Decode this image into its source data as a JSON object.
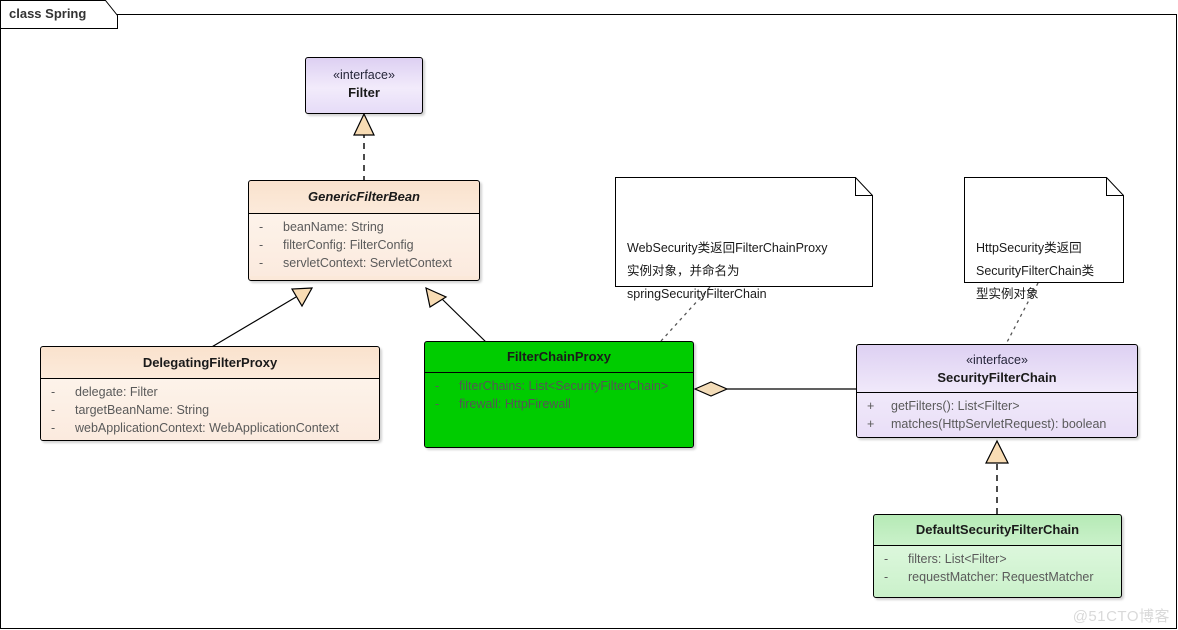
{
  "frame": {
    "label": "class Spring"
  },
  "watermark": "@51CTO博客",
  "colors": {
    "interface_fill": "#e3d6f5",
    "abstract_fill": "#fae2cd",
    "highlight_green": "#00cc00",
    "light_green": "#c8f0c8",
    "arrow_fill": "#f8dcb4",
    "line": "#000000"
  },
  "classes": {
    "filter": {
      "stereotype": "«interface»",
      "name": "Filter",
      "attributes": []
    },
    "generic_filter_bean": {
      "stereotype": "",
      "name": "GenericFilterBean",
      "attributes": [
        {
          "visibility": "-",
          "text": "beanName: String"
        },
        {
          "visibility": "-",
          "text": "filterConfig: FilterConfig"
        },
        {
          "visibility": "-",
          "text": "servletContext: ServletContext"
        }
      ]
    },
    "delegating_filter_proxy": {
      "stereotype": "",
      "name": "DelegatingFilterProxy",
      "attributes": [
        {
          "visibility": "-",
          "text": "delegate: Filter"
        },
        {
          "visibility": "-",
          "text": "targetBeanName: String"
        },
        {
          "visibility": "-",
          "text": "webApplicationContext: WebApplicationContext"
        }
      ]
    },
    "filter_chain_proxy": {
      "stereotype": "",
      "name": "FilterChainProxy",
      "attributes": [
        {
          "visibility": "-",
          "text": "filterChains: List<SecurityFilterChain>"
        },
        {
          "visibility": "-",
          "text": "firewall: HttpFirewall"
        }
      ]
    },
    "security_filter_chain": {
      "stereotype": "«interface»",
      "name": "SecurityFilterChain",
      "attributes": [
        {
          "visibility": "+",
          "text": "getFilters(): List<Filter>"
        },
        {
          "visibility": "+",
          "text": "matches(HttpServletRequest): boolean"
        }
      ]
    },
    "default_security_filter_chain": {
      "stereotype": "",
      "name": "DefaultSecurityFilterChain",
      "attributes": [
        {
          "visibility": "-",
          "text": "filters: List<Filter>"
        },
        {
          "visibility": "-",
          "text": "requestMatcher: RequestMatcher"
        }
      ]
    }
  },
  "notes": {
    "web_security": {
      "text": "WebSecurity类返回FilterChainProxy\n实例对象，并命名为\nspringSecurityFilterChain"
    },
    "http_security": {
      "text": "HttpSecurity类返回\nSecurityFilterChain类\n型实例对象"
    }
  },
  "relationships": [
    {
      "type": "realization",
      "from": "GenericFilterBean",
      "to": "Filter"
    },
    {
      "type": "generalization",
      "from": "DelegatingFilterProxy",
      "to": "GenericFilterBean"
    },
    {
      "type": "generalization",
      "from": "FilterChainProxy",
      "to": "GenericFilterBean"
    },
    {
      "type": "aggregation",
      "from": "FilterChainProxy",
      "to": "SecurityFilterChain"
    },
    {
      "type": "realization",
      "from": "DefaultSecurityFilterChain",
      "to": "SecurityFilterChain"
    },
    {
      "type": "note-link",
      "from": "WebSecurity note",
      "to": "FilterChainProxy"
    },
    {
      "type": "note-link",
      "from": "HttpSecurity note",
      "to": "SecurityFilterChain"
    }
  ]
}
